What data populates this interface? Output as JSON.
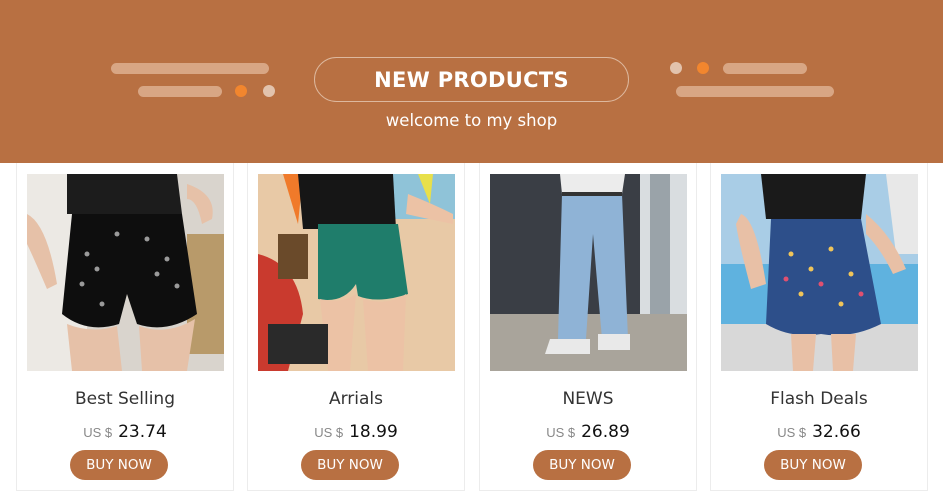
{
  "colors": {
    "banner_bg": "#b87042",
    "accent_dot": "#f2862e",
    "button_bg": "#b87042",
    "button_text": "#ffffff"
  },
  "banner": {
    "title": "NEW PRODUCTS",
    "subtitle": "welcome to my shop"
  },
  "products": [
    {
      "name": "Best Selling",
      "currency": "US $",
      "price": "23.74",
      "button": "BUY NOW",
      "image": "black denim shorts with studs"
    },
    {
      "name": "Arrials",
      "currency": "US $",
      "price": "18.99",
      "button": "BUY NOW",
      "image": "green denim shorts on beach"
    },
    {
      "name": "NEWS",
      "currency": "US $",
      "price": "26.89",
      "button": "BUY NOW",
      "image": "light blue wide leg jeans"
    },
    {
      "name": "Flash Deals",
      "currency": "US $",
      "price": "32.66",
      "button": "BUY NOW",
      "image": "denim skirt with rhinestones"
    }
  ]
}
